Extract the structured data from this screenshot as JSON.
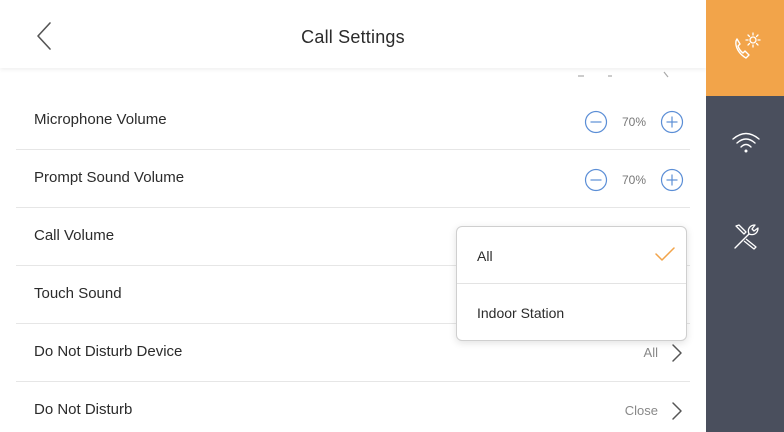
{
  "header": {
    "title": "Call Settings"
  },
  "rows": [
    {
      "label": "Microphone Volume",
      "value": "70%"
    },
    {
      "label": "Prompt Sound Volume",
      "value": "70%"
    },
    {
      "label": "Call Volume"
    },
    {
      "label": "Touch Sound"
    },
    {
      "label": "Do Not Disturb Device",
      "value": "All"
    },
    {
      "label": "Do Not Disturb",
      "value": "Close"
    }
  ],
  "dropdown": {
    "options": [
      {
        "label": "All",
        "selected": true
      },
      {
        "label": "Indoor Station",
        "selected": false
      }
    ]
  },
  "sidebar": {
    "items": [
      {
        "icon": "call-settings-icon",
        "active": true
      },
      {
        "icon": "wifi-icon",
        "active": false
      },
      {
        "icon": "tools-icon",
        "active": false
      }
    ]
  },
  "colors": {
    "accent": "#f2a44a",
    "sidebar": "#4a4f5d",
    "volume_button": "#5b8ed6"
  }
}
